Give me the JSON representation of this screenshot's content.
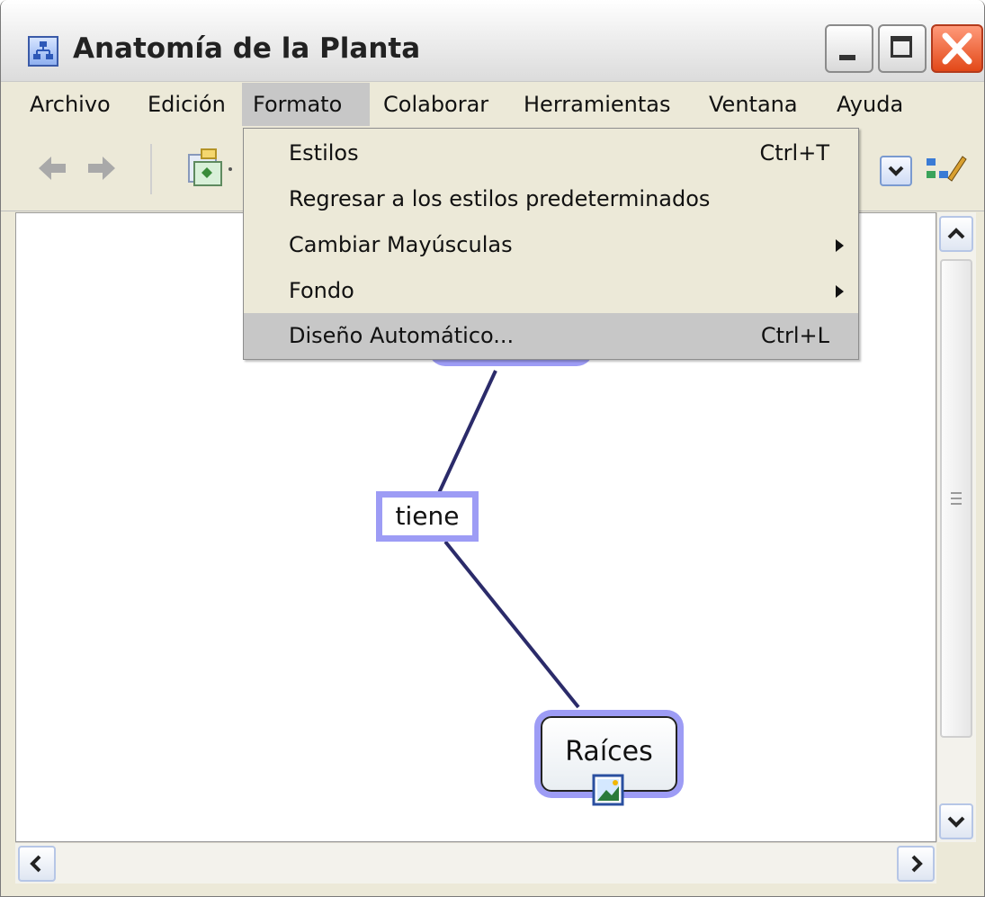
{
  "window": {
    "title": "Anatomía de la Planta"
  },
  "menubar": {
    "items": [
      {
        "label": "Archivo"
      },
      {
        "label": "Edición"
      },
      {
        "label": "Formato"
      },
      {
        "label": "Colaborar"
      },
      {
        "label": "Herramientas"
      },
      {
        "label": "Ventana"
      },
      {
        "label": "Ayuda"
      }
    ],
    "active": "Formato"
  },
  "format_menu": {
    "items": [
      {
        "label": "Estilos",
        "shortcut": "Ctrl+T"
      },
      {
        "label": "Regresar a los estilos predeterminados",
        "shortcut": ""
      },
      {
        "label": "Cambiar Mayúsculas",
        "submenu": true
      },
      {
        "label": "Fondo",
        "submenu": true
      },
      {
        "label": "Diseño Automático...",
        "shortcut": "Ctrl+L",
        "highlighted": true
      }
    ]
  },
  "map": {
    "link_label": "tiene",
    "concept": "Raíces",
    "colors": {
      "node_halo": "#9d9cf5",
      "connector": "#2b2b6a"
    }
  }
}
